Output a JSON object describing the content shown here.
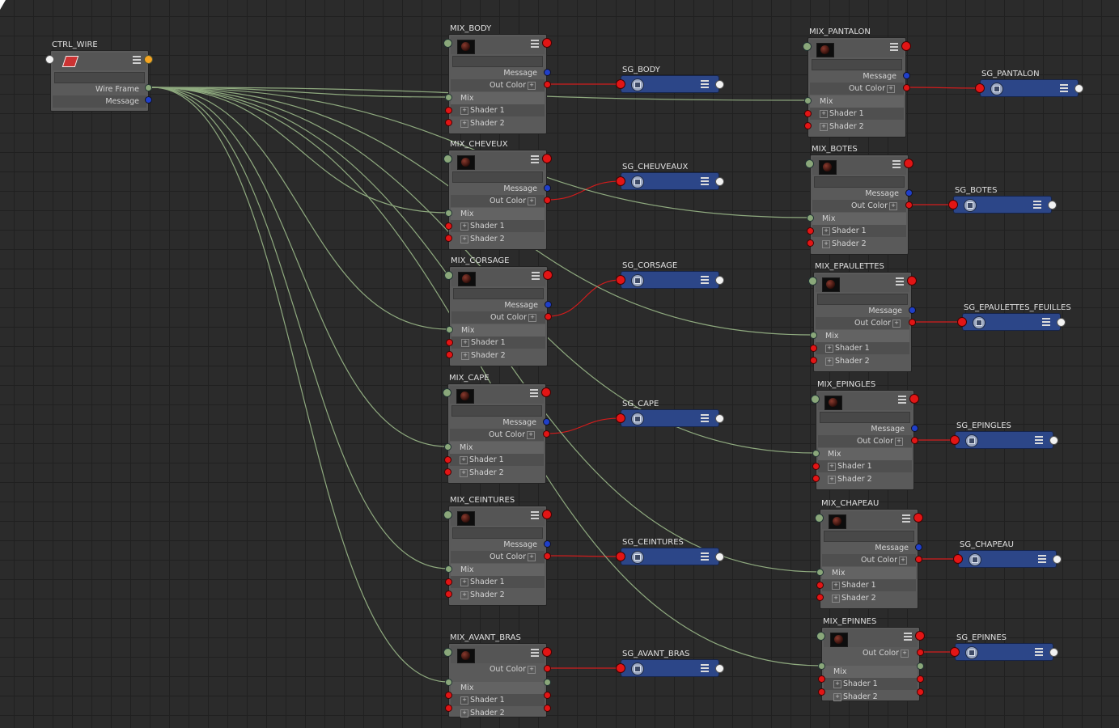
{
  "ctrl": {
    "title": "CTRL_WIRE",
    "ports": [
      "Wire Frame",
      "Message"
    ]
  },
  "mix_labels": {
    "message": "Message",
    "out": "Out Color",
    "mix": "Mix",
    "s1": "Shader 1",
    "s2": "Shader 2"
  },
  "mix_nodes": [
    {
      "title": "MIX_BODY"
    },
    {
      "title": "MIX_CHEVEUX"
    },
    {
      "title": "MIX_CORSAGE"
    },
    {
      "title": "MIX_CAPE"
    },
    {
      "title": "MIX_CEINTURES"
    },
    {
      "title": "MIX_AVANT_BRAS"
    },
    {
      "title": "MIX_PANTALON"
    },
    {
      "title": "MIX_BOTES"
    },
    {
      "title": "MIX_EPAULETTES"
    },
    {
      "title": "MIX_EPINGLES"
    },
    {
      "title": "MIX_CHAPEAU"
    },
    {
      "title": "MIX_EPINNES"
    }
  ],
  "sg_nodes": [
    {
      "title": "SG_BODY"
    },
    {
      "title": "SG_CHEUVEAUX"
    },
    {
      "title": "SG_CORSAGE"
    },
    {
      "title": "SG_CAPE"
    },
    {
      "title": "SG_CEINTURES"
    },
    {
      "title": "SG_AVANT_BRAS"
    },
    {
      "title": "SG_PANTALON"
    },
    {
      "title": "SG_BOTES"
    },
    {
      "title": "SG_EPAULETTES_FEUILLES"
    },
    {
      "title": "SG_EPINGLES"
    },
    {
      "title": "SG_CHAPEAU"
    },
    {
      "title": "SG_EPINNES"
    }
  ],
  "colors": {
    "mix_wire": "#8faa7f",
    "color_wire": "#d21c1c",
    "background": "#2b2b2b"
  }
}
